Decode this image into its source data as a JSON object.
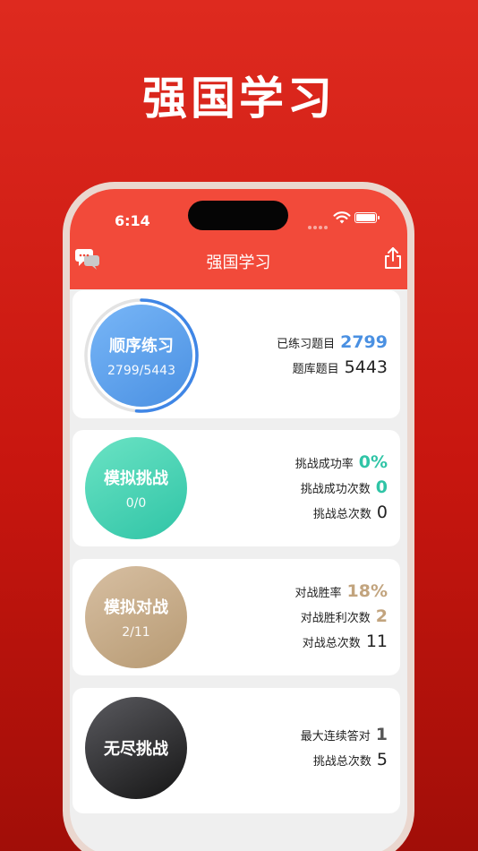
{
  "headline": "强国学习",
  "status": {
    "time": "6:14"
  },
  "nav": {
    "title": "强国学习"
  },
  "colors": {
    "brand_red": "#f24a3a",
    "blue": "#4a90e2",
    "teal": "#2fc4a6",
    "tan": "#c2a47e",
    "dark": "#2b2b2b"
  },
  "cards": [
    {
      "title": "顺序练习",
      "subtitle": "2799/5443",
      "progress": 0.514,
      "stats": [
        {
          "label": "已练习题目",
          "value": "2799"
        },
        {
          "label": "题库题目",
          "value": "5443"
        }
      ]
    },
    {
      "title": "模拟挑战",
      "subtitle": "0/0",
      "stats": [
        {
          "label": "挑战成功率",
          "value": "0%"
        },
        {
          "label": "挑战成功次数",
          "value": "0"
        },
        {
          "label": "挑战总次数",
          "value": "0"
        }
      ]
    },
    {
      "title": "模拟对战",
      "subtitle": "2/11",
      "stats": [
        {
          "label": "对战胜率",
          "value": "18%"
        },
        {
          "label": "对战胜利次数",
          "value": "2"
        },
        {
          "label": "对战总次数",
          "value": "11"
        }
      ]
    },
    {
      "title": "无尽挑战",
      "stats": [
        {
          "label": "最大连续答对",
          "value": "1"
        },
        {
          "label": "挑战总次数",
          "value": "5"
        }
      ]
    }
  ]
}
